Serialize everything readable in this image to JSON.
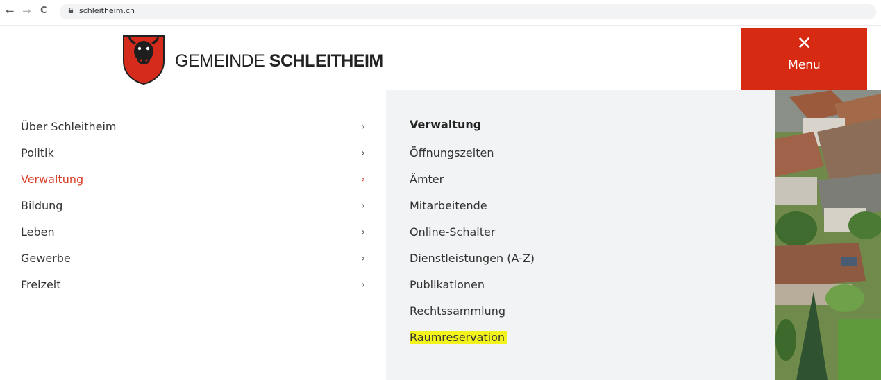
{
  "browser": {
    "url": "schleitheim.ch",
    "back_glyph": "←",
    "forward_glyph": "→",
    "reload_glyph": "C"
  },
  "header": {
    "brand_light": "GEMEINDE ",
    "brand_bold": "SCHLEITHEIM",
    "menu_close_glyph": "✕",
    "menu_label": "Menu",
    "menu_color": "#d72a12"
  },
  "left_nav": {
    "items": [
      {
        "label": "Über Schleitheim",
        "chevron": "›"
      },
      {
        "label": "Politik",
        "chevron": "›"
      },
      {
        "label": "Verwaltung",
        "chevron": "›"
      },
      {
        "label": "Bildung",
        "chevron": "›"
      },
      {
        "label": "Leben",
        "chevron": "›"
      },
      {
        "label": "Gewerbe",
        "chevron": "›"
      },
      {
        "label": "Freizeit",
        "chevron": "›"
      }
    ],
    "active_color": "#d7402a"
  },
  "submenu": {
    "title": "Verwaltung",
    "items": [
      "Öffnungszeiten",
      "Ämter",
      "Mitarbeitende",
      "Online-Schalter",
      "Dienstleistungen (A-Z)",
      "Publikationen",
      "Rechtssammlung",
      "Raumreservation"
    ],
    "highlight_color": "#f2f21c"
  }
}
